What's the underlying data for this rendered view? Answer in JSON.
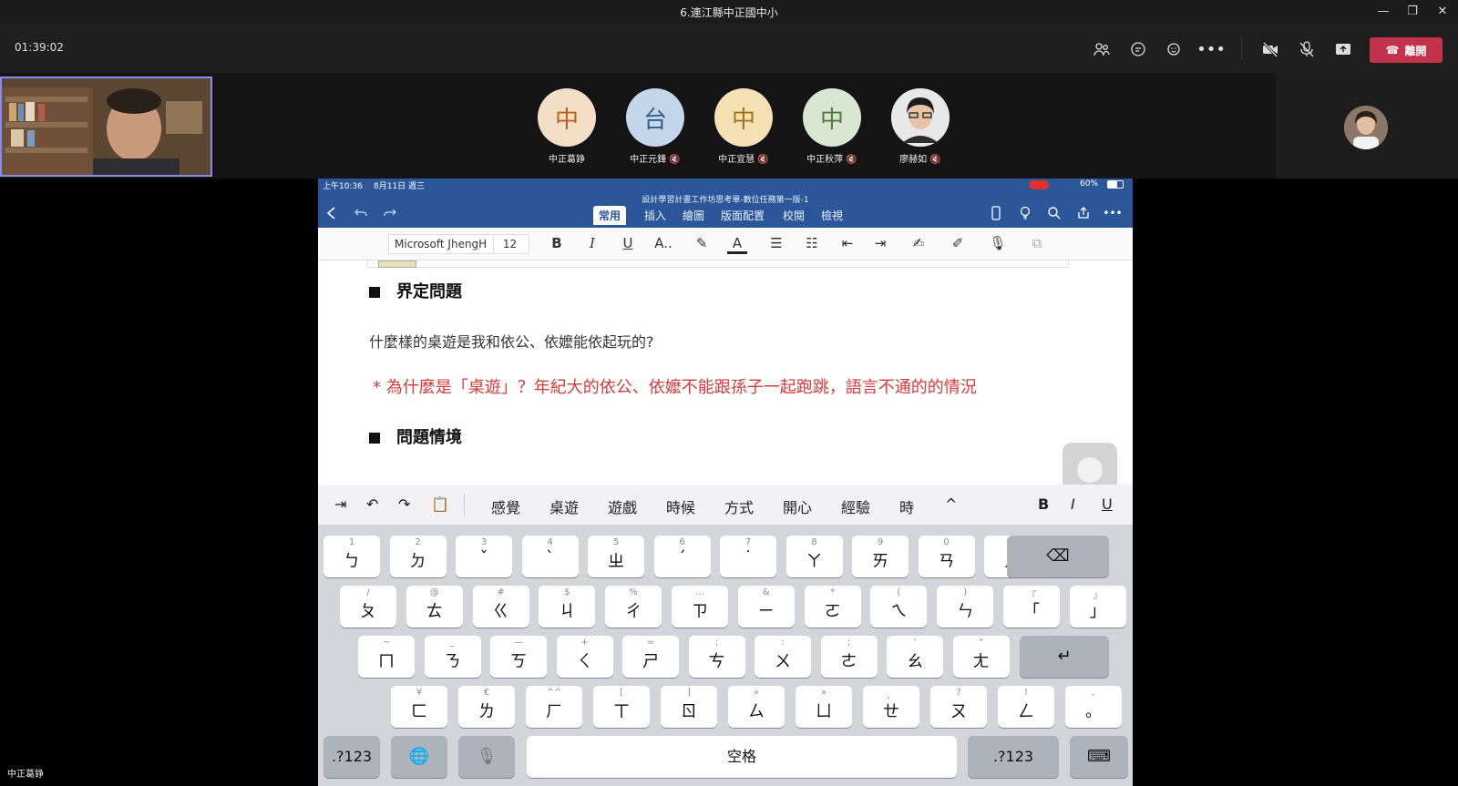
{
  "window": {
    "title": "6.連江縣中正國中小"
  },
  "meeting": {
    "timer": "01:39:02",
    "leave_label": "離開",
    "self_name": "中正葛錚"
  },
  "participants": [
    {
      "initial": "中",
      "name": "中正葛錚",
      "bg": "#f3dfc6",
      "fg": "#b5651d"
    },
    {
      "initial": "台",
      "name": "中正元鋒",
      "bg": "#c4d6ea",
      "fg": "#355f8a"
    },
    {
      "initial": "中",
      "name": "中正宜慧",
      "bg": "#f5e1b3",
      "fg": "#a0741b"
    },
    {
      "initial": "中",
      "name": "中正秋萍",
      "bg": "#d8e6d2",
      "fg": "#4e7a3f"
    },
    {
      "initial": "",
      "name": "廖赫如",
      "bg": "#dedede",
      "fg": "#333"
    }
  ],
  "ipad": {
    "status_time": "上午10:36",
    "status_date": "8月11日 週三",
    "battery": "60%",
    "doc_title": "設計學習計畫工作坊思考單-數位任務第一版-1",
    "tabs": [
      "常用",
      "插入",
      "繪圖",
      "版面配置",
      "校閱",
      "檢視"
    ],
    "font_name": "Microsoft JhengH",
    "font_size": "12"
  },
  "document": {
    "heading1": "界定問題",
    "question": "什麼樣的桌遊是我和依公、依嬤能依起玩的?",
    "note": "* 為什麼是「桌遊」？年紀大的依公、依嬤不能跟孫子一起跑跳，語言不通的的情況",
    "heading2": "問題情境"
  },
  "keyboard": {
    "suggestions": [
      "感覺",
      "桌遊",
      "遊戲",
      "時候",
      "方式",
      "開心",
      "經驗",
      "時"
    ],
    "row1": [
      {
        "sub": "1",
        "main": "ㄅ"
      },
      {
        "sub": "2",
        "main": "ㄉ"
      },
      {
        "sub": "3",
        "main": "ˇ"
      },
      {
        "sub": "4",
        "main": "ˋ"
      },
      {
        "sub": "5",
        "main": "ㄓ"
      },
      {
        "sub": "6",
        "main": "ˊ"
      },
      {
        "sub": "7",
        "main": "˙"
      },
      {
        "sub": "8",
        "main": "ㄚ"
      },
      {
        "sub": "9",
        "main": "ㄞ"
      },
      {
        "sub": "0",
        "main": "ㄢ"
      },
      {
        "sub": "-",
        "main": "ㄦ"
      }
    ],
    "row2": [
      {
        "sub": "/",
        "main": "ㄆ"
      },
      {
        "sub": "@",
        "main": "ㄊ"
      },
      {
        "sub": "#",
        "main": "ㄍ"
      },
      {
        "sub": "$",
        "main": "ㄐ"
      },
      {
        "sub": "%",
        "main": "ㄔ"
      },
      {
        "sub": "…",
        "main": "ㄗ"
      },
      {
        "sub": "&",
        "main": "ㄧ"
      },
      {
        "sub": "*",
        "main": "ㄛ"
      },
      {
        "sub": "(",
        "main": "ㄟ"
      },
      {
        "sub": ")",
        "main": "ㄣ"
      },
      {
        "sub": "『",
        "main": "「"
      },
      {
        "sub": "』",
        "main": "」"
      }
    ],
    "row3": [
      {
        "sub": "~",
        "main": "ㄇ"
      },
      {
        "sub": "_",
        "main": "ㄋ"
      },
      {
        "sub": "—",
        "main": "ㄎ"
      },
      {
        "sub": "+",
        "main": "ㄑ"
      },
      {
        "sub": "=",
        "main": "ㄕ"
      },
      {
        "sub": ";",
        "main": "ㄘ"
      },
      {
        "sub": ":",
        "main": "ㄨ"
      },
      {
        "sub": ";",
        "main": "ㄜ"
      },
      {
        "sub": "'",
        "main": "ㄠ"
      },
      {
        "sub": "\"",
        "main": "ㄤ"
      }
    ],
    "row4": [
      {
        "sub": "¥",
        "main": "ㄈ"
      },
      {
        "sub": "€",
        "main": "ㄌ"
      },
      {
        "sub": "^^",
        "main": "ㄏ"
      },
      {
        "sub": "[",
        "main": "ㄒ"
      },
      {
        "sub": "]",
        "main": "ㄖ"
      },
      {
        "sub": "«",
        "main": "ㄙ"
      },
      {
        "sub": "»",
        "main": "ㄩ"
      },
      {
        "sub": "、",
        "main": "ㄝ"
      },
      {
        "sub": "?",
        "main": "ㄡ"
      },
      {
        "sub": "!",
        "main": "ㄥ"
      },
      {
        "sub": ",",
        "main": "。"
      }
    ],
    "num_label": ".?123",
    "space_label": "空格"
  }
}
